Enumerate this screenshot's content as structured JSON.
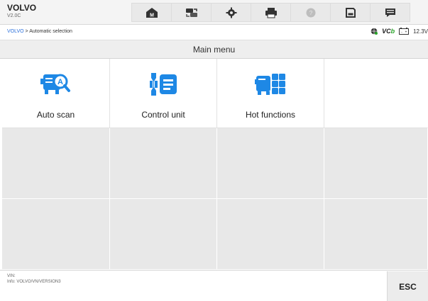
{
  "header": {
    "brand": "VOLVO",
    "version": "V2.0C",
    "toolbar": [
      {
        "name": "home-icon"
      },
      {
        "name": "vehicle-swap-icon"
      },
      {
        "name": "settings-gear-icon"
      },
      {
        "name": "printer-icon"
      },
      {
        "name": "help-icon"
      },
      {
        "name": "save-icon"
      },
      {
        "name": "data-logging-icon"
      }
    ]
  },
  "breadcrumb": {
    "root": "VOLVO",
    "separator": " > ",
    "current": "Automatic selection"
  },
  "status": {
    "vci_prefix": "VC",
    "vci_suffix": "b",
    "battery": "12.3V"
  },
  "main": {
    "title": "Main menu",
    "items": [
      {
        "label": "Auto scan",
        "icon": "auto-scan-icon"
      },
      {
        "label": "Control unit",
        "icon": "control-unit-icon"
      },
      {
        "label": "Hot functions",
        "icon": "hot-functions-icon"
      }
    ]
  },
  "footer": {
    "vin_label": "VIN:",
    "info": "Info: VOLVO/VN/VERSION3",
    "esc_label": "ESC"
  },
  "colors": {
    "accent": "#2a6fdb",
    "icon_blue": "#1e88e5",
    "vci_green": "#2aa52a"
  }
}
